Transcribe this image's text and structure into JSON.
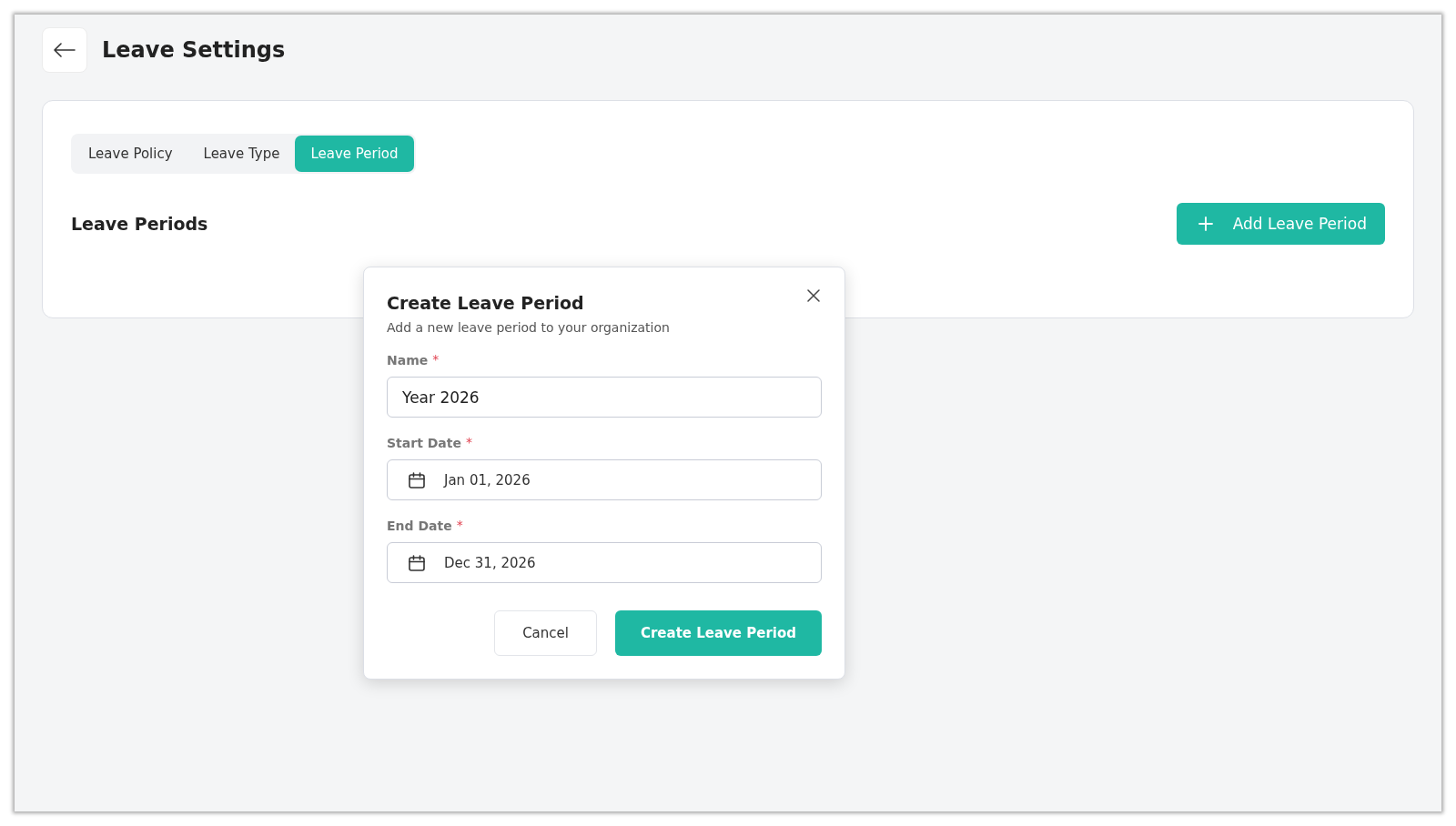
{
  "header": {
    "title": "Leave Settings"
  },
  "tabs": [
    {
      "label": "Leave Policy",
      "selected": false
    },
    {
      "label": "Leave Type",
      "selected": false
    },
    {
      "label": "Leave Period",
      "selected": true
    }
  ],
  "section": {
    "title": "Leave Periods",
    "add_button": "Add Leave Period"
  },
  "dialog": {
    "title": "Create Leave Period",
    "subtitle": "Add a new leave period to your organization",
    "fields": [
      {
        "kind": "text",
        "label": "Name",
        "required_mark": "*",
        "value": "Year 2026"
      },
      {
        "kind": "date",
        "label": "Start Date",
        "required_mark": "*",
        "value": "Jan 01, 2026"
      },
      {
        "kind": "date",
        "label": "End Date",
        "required_mark": "*",
        "value": "Dec 31, 2026"
      }
    ],
    "buttons": {
      "cancel": "Cancel",
      "submit": "Create Leave Period"
    }
  }
}
